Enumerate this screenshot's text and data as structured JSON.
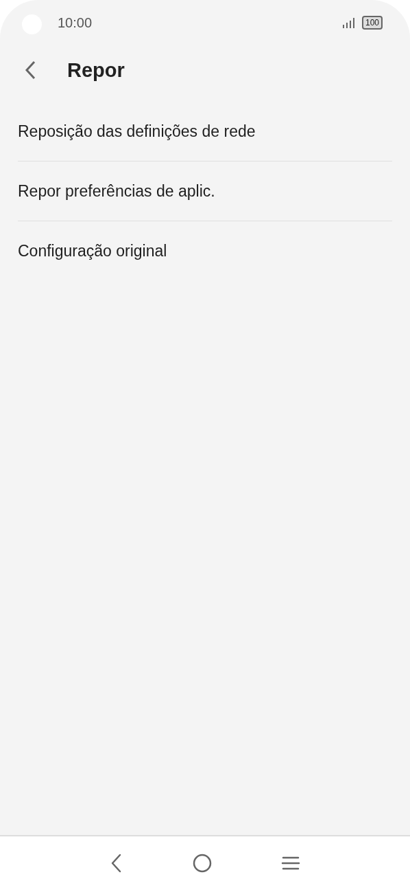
{
  "status_bar": {
    "time": "10:00",
    "battery": "100"
  },
  "header": {
    "title": "Repor"
  },
  "items": [
    {
      "label": "Reposição das definições de rede"
    },
    {
      "label": "Repor preferências de aplic."
    },
    {
      "label": "Configuração original"
    }
  ]
}
